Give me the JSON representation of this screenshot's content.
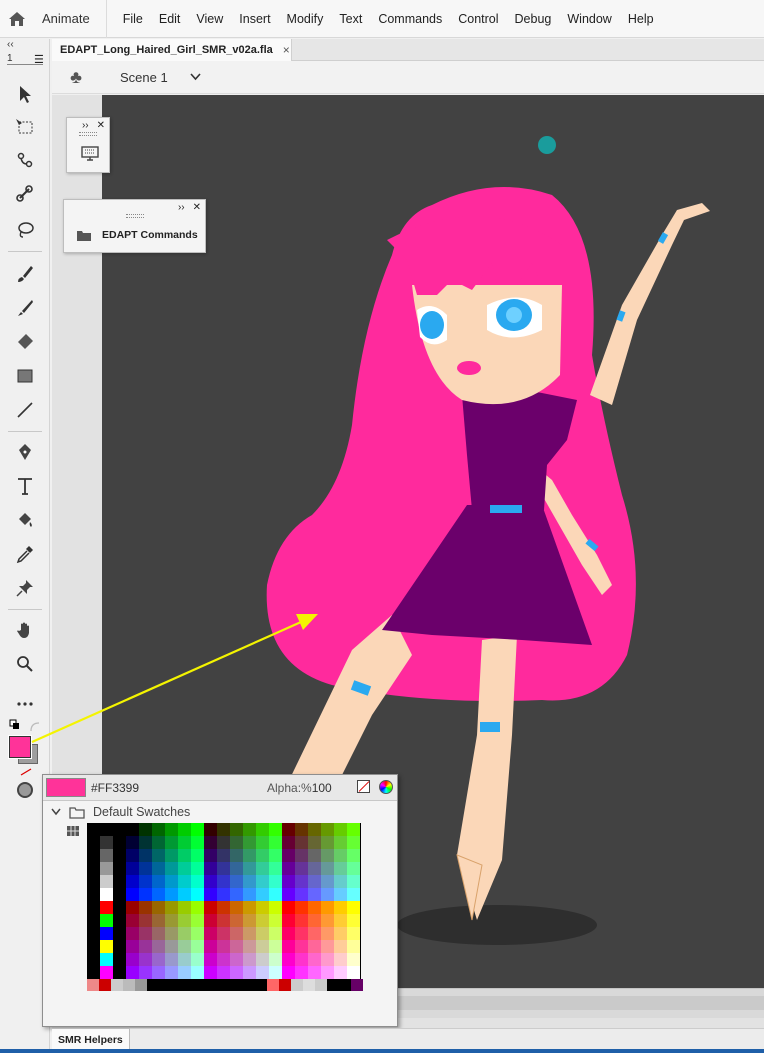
{
  "app": {
    "name": "Animate"
  },
  "menu": [
    "File",
    "Edit",
    "View",
    "Insert",
    "Modify",
    "Text",
    "Commands",
    "Control",
    "Debug",
    "Window",
    "Help"
  ],
  "document": {
    "tab_title": "EDAPT_Long_Haired_Girl_SMR_v02a.fla",
    "close_glyph": "×"
  },
  "scene": {
    "label": "Scene 1"
  },
  "toolbar": {
    "collapse_glyph": "‹‹",
    "frame_number": "1",
    "tools": [
      "selection-tool-icon",
      "free-transform-tool-icon",
      "subselection-tool-icon",
      "bone-tool-icon",
      "lasso-tool-icon",
      "paint-brush-tool-icon",
      "brush-tool-icon",
      "eraser-tool-icon",
      "rectangle-tool-icon",
      "line-tool-icon",
      "pen-tool-icon",
      "text-tool-icon",
      "paint-bucket-tool-icon",
      "eyedropper-tool-icon",
      "pin-tool-icon",
      "hand-tool-icon",
      "zoom-tool-icon",
      "more-tools-icon"
    ],
    "fill_color": "#FF3399",
    "stroke_color": "#9e9e9e"
  },
  "panels": {
    "small_panel": {
      "icon": "monitor-icon"
    },
    "edapt_panel": {
      "label": "EDAPT Commands"
    }
  },
  "swatches": {
    "hex": "#FF3399",
    "alpha_label": "Alpha:%",
    "alpha_value": "100",
    "folder_label": "Default Swatches"
  },
  "bottom_panel": {
    "tab_label": "SMR Helpers"
  },
  "colors": {
    "stage": "#424242",
    "hair": "#ff2a9d",
    "dress": "#6b006b",
    "skin": "#fbd7b8",
    "eyes": "#2aa9f0",
    "teal_dot": "#1a9c9c",
    "annotation_arrow": "#f4f400"
  }
}
